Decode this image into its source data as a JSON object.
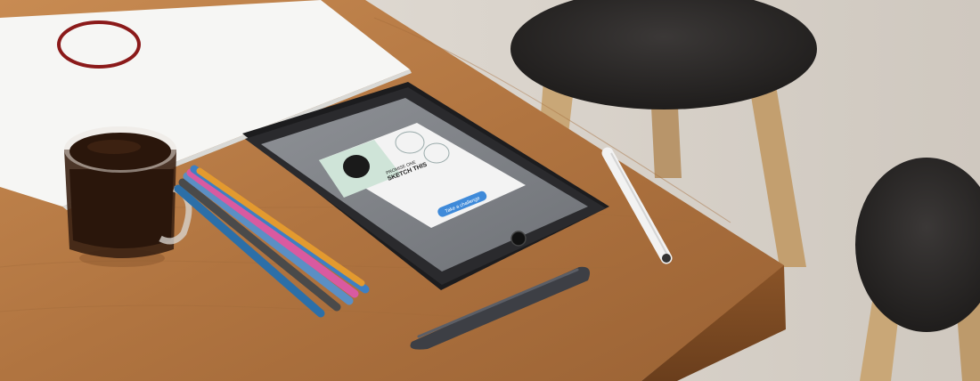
{
  "scene": {
    "description_labels": [],
    "colors": {
      "wall": "#ddd7cf",
      "table_top": "#b77a45",
      "table_edge": "#7a4a24",
      "paper": "#f7f7f5",
      "coffee": "#2a160b",
      "tablet_bezel": "#1c1c1e",
      "stool_seat": "#2c2a29",
      "stool_leg": "#c8a679",
      "circle_marker": "#8b1a1a"
    }
  },
  "tablet": {
    "dialog_title_line1": "PROMISE ONE",
    "dialog_title_line2": "SKETCH THIS",
    "button_label": "Take a challenge"
  }
}
